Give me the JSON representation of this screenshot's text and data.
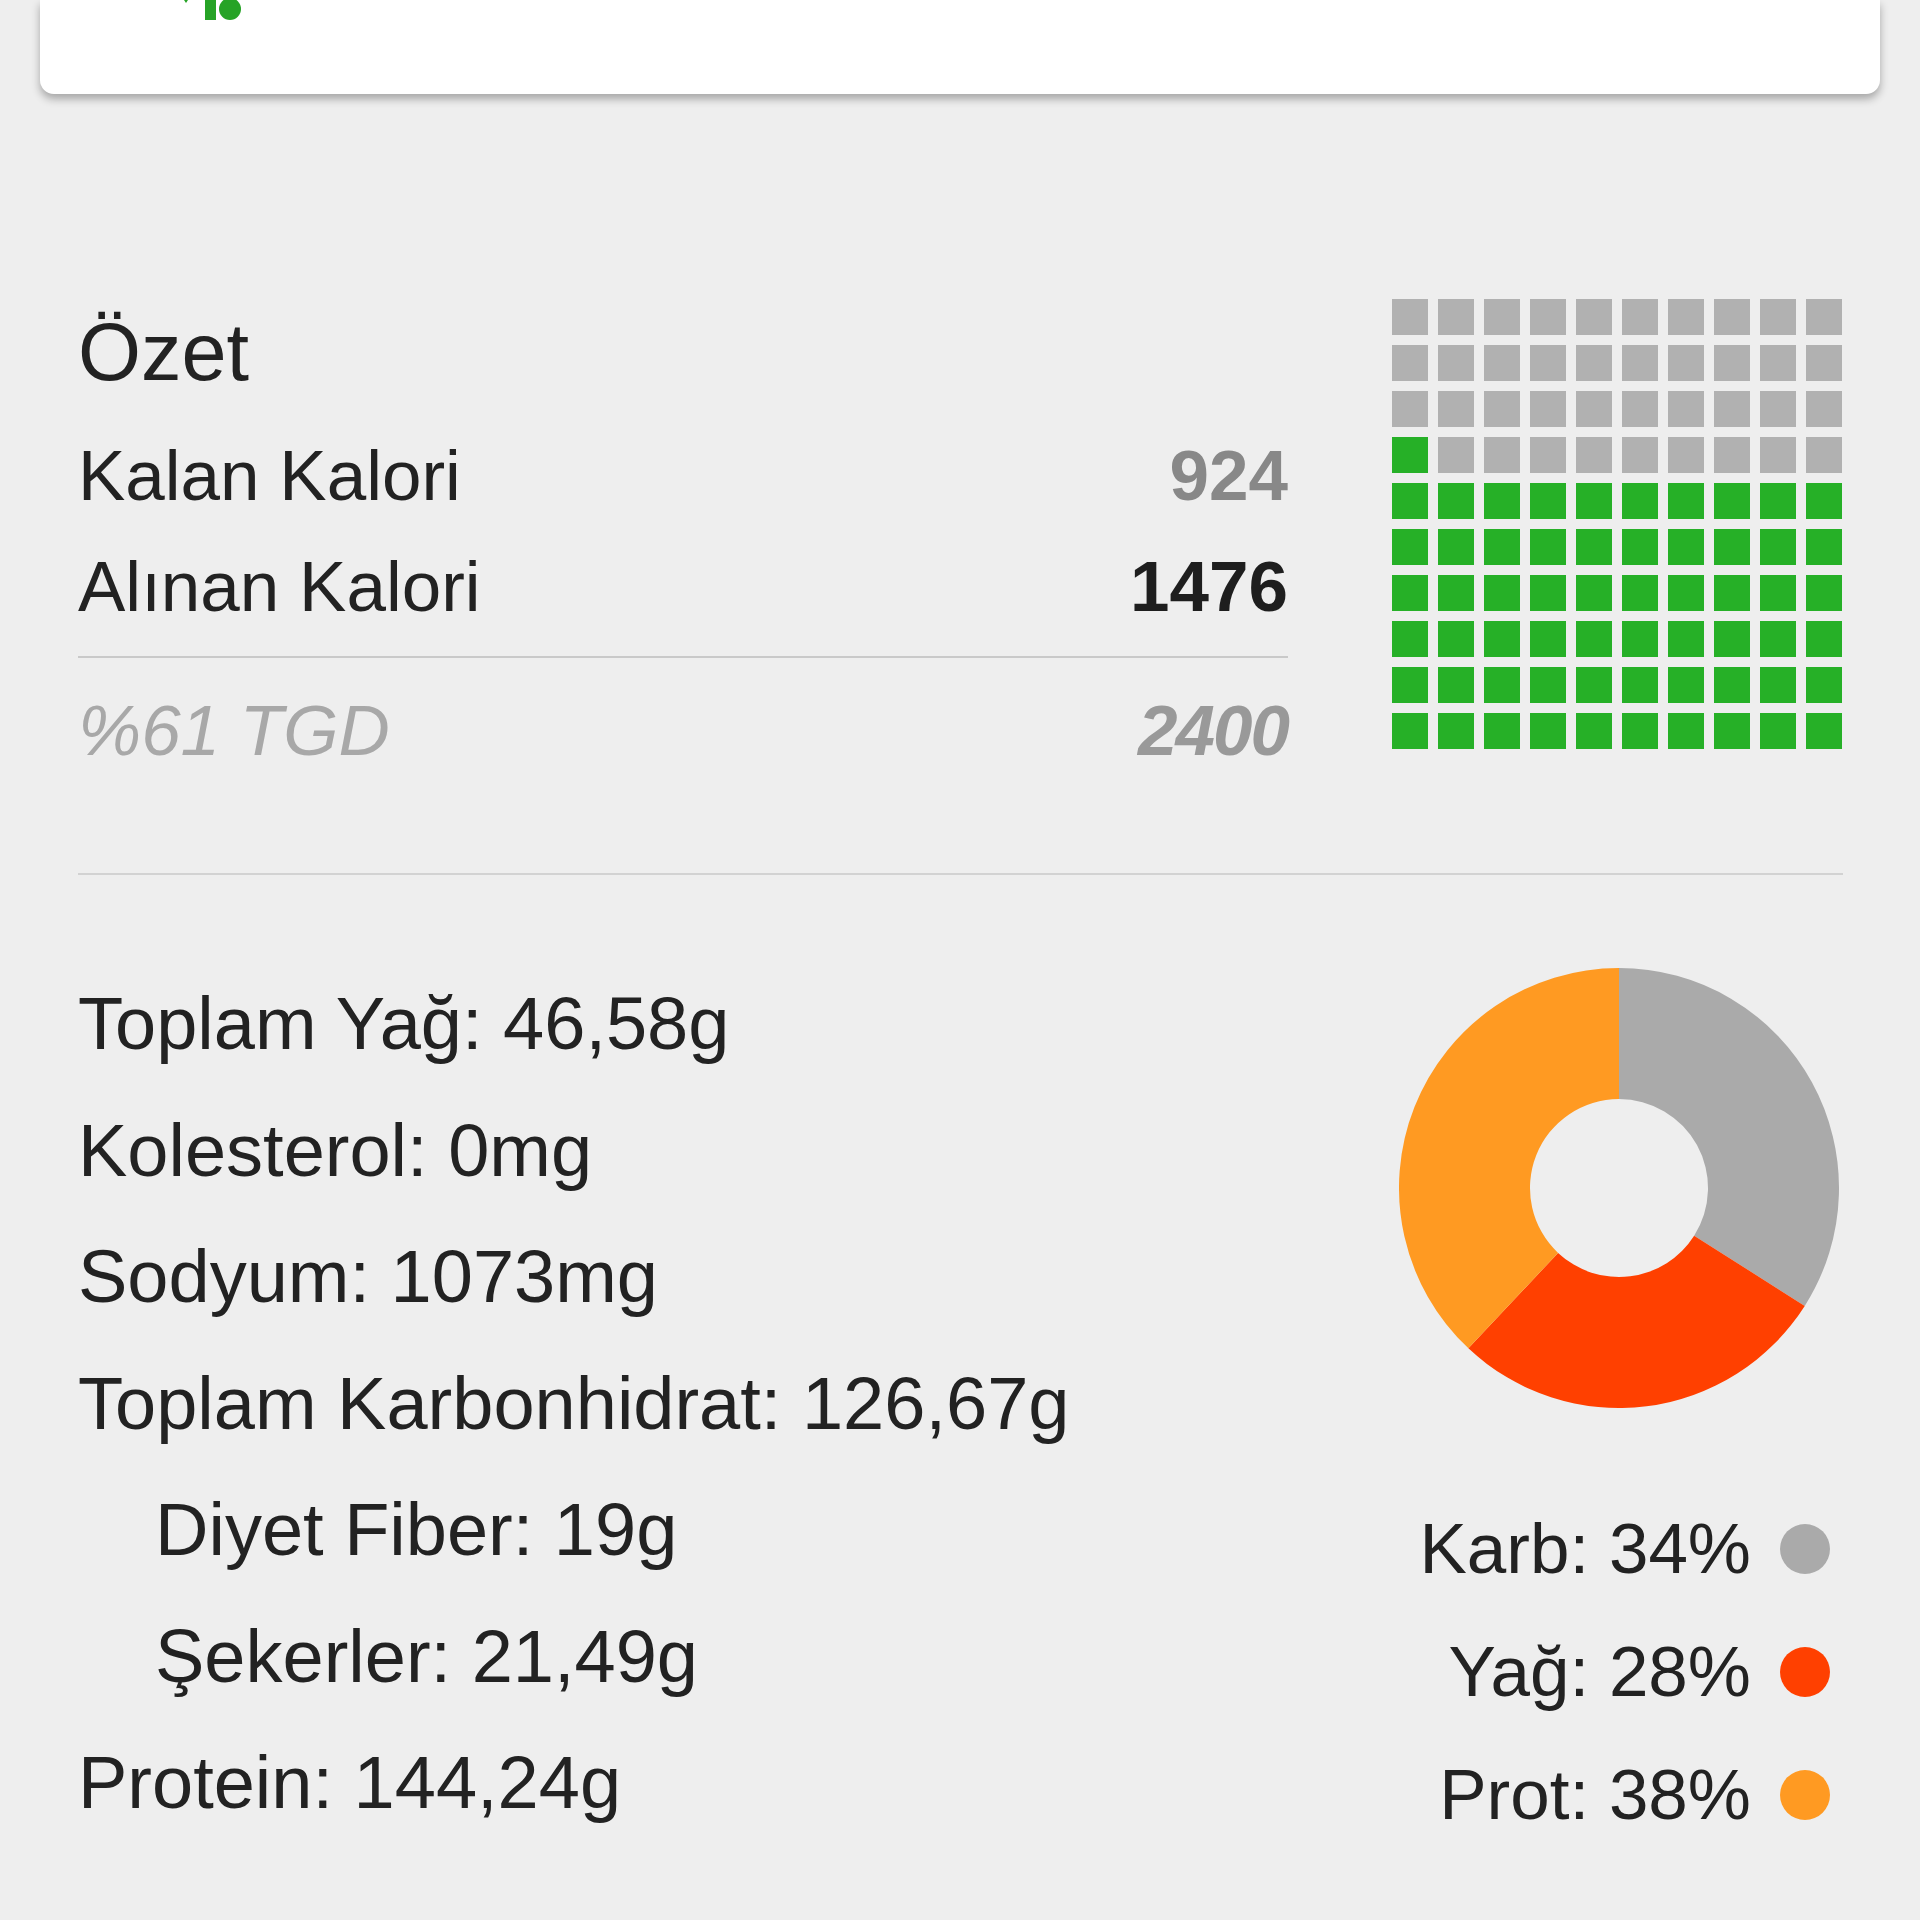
{
  "summary": {
    "title": "Özet",
    "rows": [
      {
        "kind": "remaining",
        "label": "Kalan Kalori",
        "value": "924"
      },
      {
        "kind": "consumed",
        "label": "Alınan Kalori",
        "value": "1476"
      }
    ],
    "goal": {
      "label": "%61 TGD",
      "value": "2400"
    },
    "waffle": {
      "squares": [
        {
          "filled": false
        },
        {
          "filled": false
        },
        {
          "filled": false
        },
        {
          "filled": false
        },
        {
          "filled": false
        },
        {
          "filled": false
        },
        {
          "filled": false
        },
        {
          "filled": false
        },
        {
          "filled": false
        },
        {
          "filled": false
        },
        {
          "filled": false
        },
        {
          "filled": false
        },
        {
          "filled": false
        },
        {
          "filled": false
        },
        {
          "filled": false
        },
        {
          "filled": false
        },
        {
          "filled": false
        },
        {
          "filled": false
        },
        {
          "filled": false
        },
        {
          "filled": false
        },
        {
          "filled": false
        },
        {
          "filled": false
        },
        {
          "filled": false
        },
        {
          "filled": false
        },
        {
          "filled": false
        },
        {
          "filled": false
        },
        {
          "filled": false
        },
        {
          "filled": false
        },
        {
          "filled": false
        },
        {
          "filled": false
        },
        {
          "filled": true
        },
        {
          "filled": false
        },
        {
          "filled": false
        },
        {
          "filled": false
        },
        {
          "filled": false
        },
        {
          "filled": false
        },
        {
          "filled": false
        },
        {
          "filled": false
        },
        {
          "filled": false
        },
        {
          "filled": false
        },
        {
          "filled": true
        },
        {
          "filled": true
        },
        {
          "filled": true
        },
        {
          "filled": true
        },
        {
          "filled": true
        },
        {
          "filled": true
        },
        {
          "filled": true
        },
        {
          "filled": true
        },
        {
          "filled": true
        },
        {
          "filled": true
        },
        {
          "filled": true
        },
        {
          "filled": true
        },
        {
          "filled": true
        },
        {
          "filled": true
        },
        {
          "filled": true
        },
        {
          "filled": true
        },
        {
          "filled": true
        },
        {
          "filled": true
        },
        {
          "filled": true
        },
        {
          "filled": true
        },
        {
          "filled": true
        },
        {
          "filled": true
        },
        {
          "filled": true
        },
        {
          "filled": true
        },
        {
          "filled": true
        },
        {
          "filled": true
        },
        {
          "filled": true
        },
        {
          "filled": true
        },
        {
          "filled": true
        },
        {
          "filled": true
        },
        {
          "filled": true
        },
        {
          "filled": true
        },
        {
          "filled": true
        },
        {
          "filled": true
        },
        {
          "filled": true
        },
        {
          "filled": true
        },
        {
          "filled": true
        },
        {
          "filled": true
        },
        {
          "filled": true
        },
        {
          "filled": true
        },
        {
          "filled": true
        },
        {
          "filled": true
        },
        {
          "filled": true
        },
        {
          "filled": true
        },
        {
          "filled": true
        },
        {
          "filled": true
        },
        {
          "filled": true
        },
        {
          "filled": true
        },
        {
          "filled": true
        },
        {
          "filled": true
        },
        {
          "filled": true
        },
        {
          "filled": true
        },
        {
          "filled": true
        },
        {
          "filled": true
        },
        {
          "filled": true
        },
        {
          "filled": true
        },
        {
          "filled": true
        },
        {
          "filled": true
        },
        {
          "filled": true
        },
        {
          "filled": true
        }
      ]
    }
  },
  "nutrients": [
    {
      "label": "Toplam Yağ: 46,58g"
    },
    {
      "label": "Kolesterol: 0mg"
    },
    {
      "label": "Sodyum: 1073mg"
    },
    {
      "label": "Toplam Karbonhidrat: 126,67g",
      "children": [
        {
          "label": "Diyet Fiber: 19g"
        },
        {
          "label": "Şekerler: 21,49g"
        }
      ]
    },
    {
      "label": "Protein: 144,24g"
    }
  ],
  "macros": {
    "chart_data": {
      "type": "donut",
      "values": [
        34,
        28,
        38
      ]
    },
    "legend": [
      {
        "label": "Karb: 34%",
        "color": "#aaaaaa"
      },
      {
        "label": "Yağ: 28%",
        "color": "#ff4000"
      },
      {
        "label": "Prot: 38%",
        "color": "#ff9a22"
      }
    ]
  }
}
